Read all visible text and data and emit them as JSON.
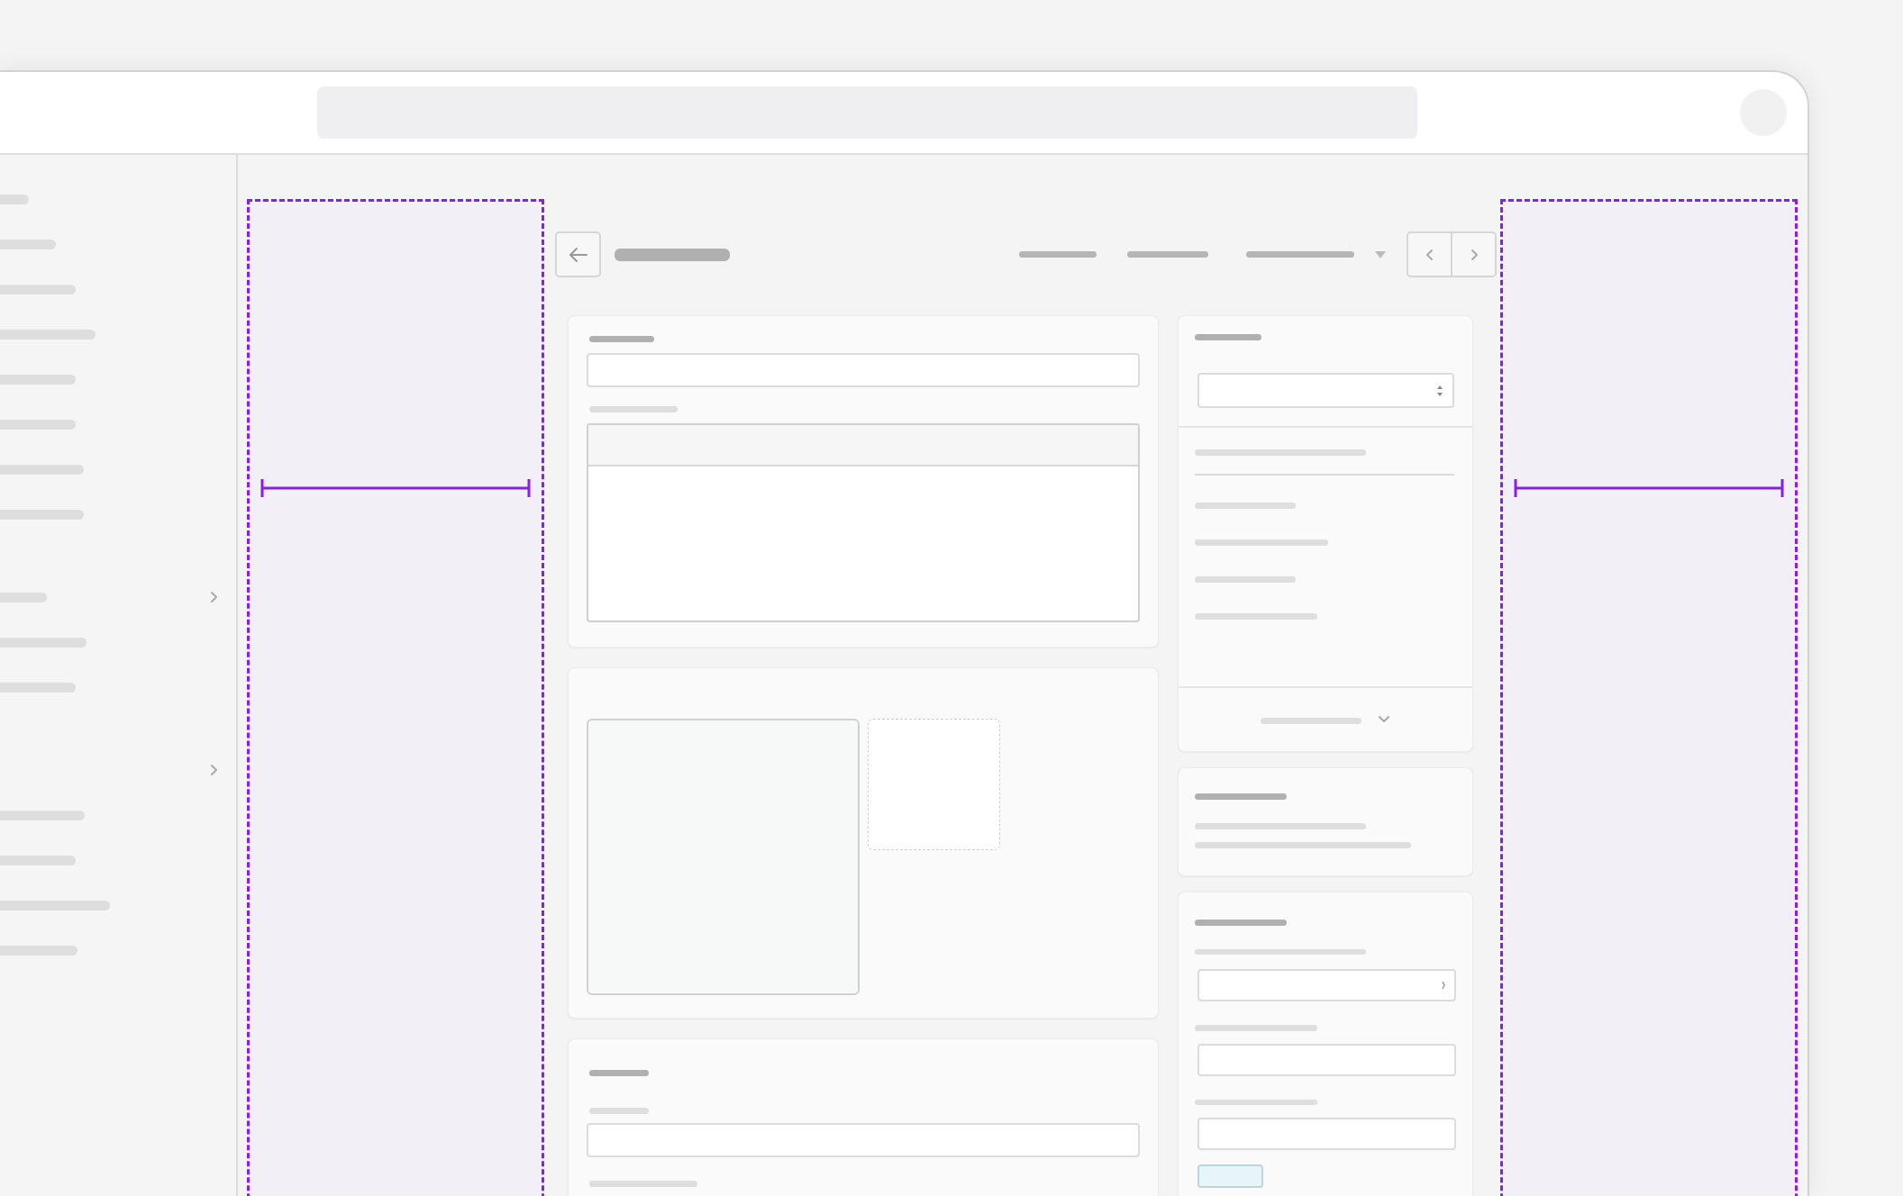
{
  "sidebar": {
    "groups": [
      {
        "expanded": false
      },
      {
        "expanded": false
      }
    ]
  }
}
